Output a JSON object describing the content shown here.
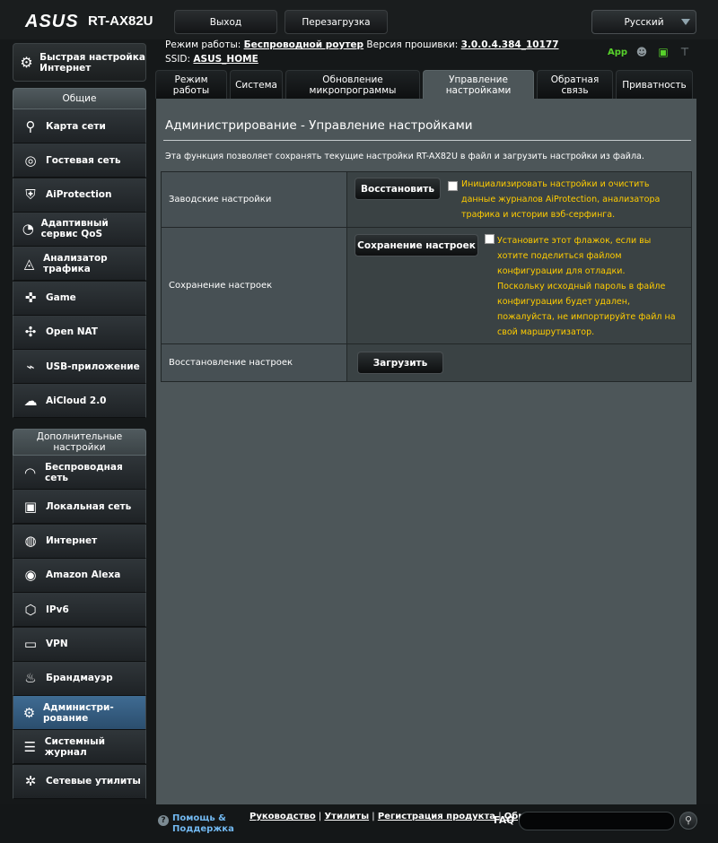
{
  "header": {
    "brand": "ASUS",
    "model": "RT-AX82U",
    "logout_label": "Выход",
    "reboot_label": "Перезагрузка",
    "language": "Русский"
  },
  "status": {
    "mode_label": "Режим работы:",
    "mode_value": "Беспроводной роутер",
    "fw_label": "Версия прошивки:",
    "fw_value": "3.0.0.4.384_10177",
    "ssid_label": "SSID:",
    "ssid_value": "ASUS_HOME",
    "app_label": "App"
  },
  "sidebar": {
    "quick_setup": "Быстрая настройка Интернет",
    "general_title": "Общие",
    "general": [
      {
        "label": "Карта сети",
        "icon": "network-map-icon"
      },
      {
        "label": "Гостевая сеть",
        "icon": "guest-network-icon"
      },
      {
        "label": "AiProtection",
        "icon": "aiprotection-icon"
      },
      {
        "label": "Адаптивный сервис QoS",
        "icon": "qos-icon"
      },
      {
        "label": "Анализатор трафика",
        "icon": "traffic-analyzer-icon"
      },
      {
        "label": "Game",
        "icon": "gamepad-icon"
      },
      {
        "label": "Open NAT",
        "icon": "open-nat-icon"
      },
      {
        "label": "USB-приложение",
        "icon": "usb-icon"
      },
      {
        "label": "AiCloud 2.0",
        "icon": "cloud-icon"
      }
    ],
    "advanced_title": "Дополнительные настройки",
    "advanced": [
      {
        "label": "Беспроводная сеть",
        "icon": "wireless-icon"
      },
      {
        "label": "Локальная сеть",
        "icon": "lan-icon"
      },
      {
        "label": "Интернет",
        "icon": "globe-icon"
      },
      {
        "label": "Amazon Alexa",
        "icon": "alexa-icon"
      },
      {
        "label": "IPv6",
        "icon": "ipv6-icon"
      },
      {
        "label": "VPN",
        "icon": "vpn-icon"
      },
      {
        "label": "Брандмауэр",
        "icon": "firewall-icon"
      },
      {
        "label": "Администри-рование",
        "icon": "admin-icon"
      },
      {
        "label": "Системный журнал",
        "icon": "log-icon"
      },
      {
        "label": "Сетевые утилиты",
        "icon": "tools-icon"
      }
    ]
  },
  "tabs": [
    "Режим работы",
    "Система",
    "Обновление микропрограммы",
    "Управление настройками",
    "Обратная связь",
    "Приватность"
  ],
  "main": {
    "title": "Администрирование - Управление настройками",
    "description": "Эта функция позволяет сохранять текущие настройки RT-AX82U в файл и загрузить настройки из файла.",
    "factory": {
      "label": "Заводские настройки",
      "button": "Восстановить",
      "note": "Инициализировать настройки и очистить данные журналов AiProtection, анализатора трафика и истории вэб-серфинга."
    },
    "save": {
      "label": "Сохранение настроек",
      "button": "Сохранение настроек",
      "note1": "Установите этот флажок, если вы хотите поделиться файлом конфигурации для отладки.",
      "note2": "Поскольку исходный пароль в файле конфигурации будет удален, пожалуйста, не импортируйте файл на свой маршрутизатор."
    },
    "restore": {
      "label": "Восстановление настроек",
      "button": "Загрузить"
    }
  },
  "footer": {
    "help": "Помощь & Поддержка",
    "manual": "Руководство",
    "utils": "Утилиты",
    "reg": "Регистрация продукта",
    "feedback": "Обратная связь",
    "faq": "FAQ"
  }
}
